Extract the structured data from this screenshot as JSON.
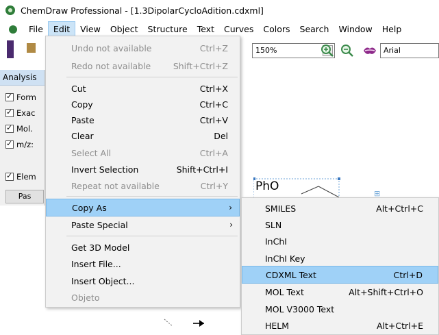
{
  "window": {
    "title": "ChemDraw Professional - [1.3DipolarCycloAdition.cdxml]"
  },
  "menubar": {
    "items": [
      "File",
      "Edit",
      "View",
      "Object",
      "Structure",
      "Text",
      "Curves",
      "Colors",
      "Search",
      "Window",
      "Help"
    ]
  },
  "toolbar": {
    "zoom_value": "150%",
    "font_value": "Arial",
    "zoom_in_icon": "zoom-in-icon",
    "zoom_out_icon": "zoom-out-icon"
  },
  "analysis": {
    "title": "Analysis",
    "rows": [
      "Form",
      "Exac",
      "Mol.",
      "m/z:",
      "Elem"
    ],
    "paste_label": "Pas"
  },
  "edit_menu": {
    "items": [
      {
        "label": "Undo not available",
        "shortcut": "Ctrl+Z",
        "disabled": true
      },
      {
        "label": "Redo not available",
        "shortcut": "Shift+Ctrl+Z",
        "disabled": true
      },
      {
        "label": "Cut",
        "shortcut": "Ctrl+X"
      },
      {
        "label": "Copy",
        "shortcut": "Ctrl+C"
      },
      {
        "label": "Paste",
        "shortcut": "Ctrl+V"
      },
      {
        "label": "Clear",
        "shortcut": "Del"
      },
      {
        "label": "Select All",
        "shortcut": "Ctrl+A",
        "disabled": true
      },
      {
        "label": "Invert Selection",
        "shortcut": "Shift+Ctrl+I"
      },
      {
        "label": "Repeat not available",
        "shortcut": "Ctrl+Y",
        "disabled": true
      },
      {
        "label": "Copy As",
        "shortcut": "",
        "submenu": true,
        "highlighted": true
      },
      {
        "label": "Paste Special",
        "shortcut": "",
        "submenu": true
      },
      {
        "label": "Get 3D Model",
        "shortcut": ""
      },
      {
        "label": "Insert File...",
        "shortcut": ""
      },
      {
        "label": "Insert Object...",
        "shortcut": ""
      },
      {
        "label": "Objeto",
        "shortcut": "",
        "disabled": true
      }
    ],
    "submenu_arrow": "›"
  },
  "copy_as_menu": {
    "items": [
      {
        "label": "SMILES",
        "shortcut": "Alt+Ctrl+C"
      },
      {
        "label": "SLN",
        "shortcut": ""
      },
      {
        "label": "InChI",
        "shortcut": ""
      },
      {
        "label": "InChI Key",
        "shortcut": ""
      },
      {
        "label": "CDXML Text",
        "shortcut": "Ctrl+D",
        "highlighted": true
      },
      {
        "label": "MOL Text",
        "shortcut": "Alt+Shift+Ctrl+O"
      },
      {
        "label": "MOL V3000 Text",
        "shortcut": ""
      },
      {
        "label": "HELM",
        "shortcut": "Alt+Ctrl+E"
      }
    ]
  },
  "canvas": {
    "fragment_label": "PhO"
  }
}
